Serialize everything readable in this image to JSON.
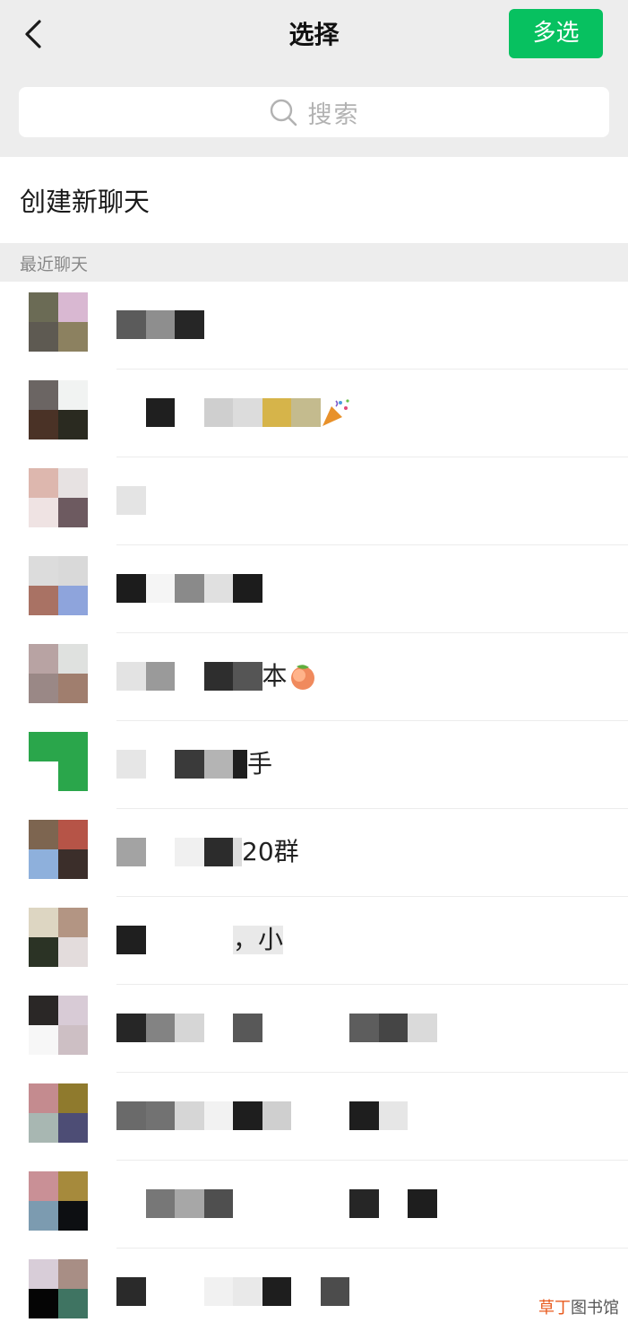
{
  "header": {
    "title": "选择",
    "multi_select_label": "多选"
  },
  "search": {
    "placeholder": "搜索"
  },
  "new_chat": {
    "label": "创建新聊天"
  },
  "recent": {
    "section_label": "最近聊天"
  },
  "chats": [
    {
      "visible_text": []
    },
    {
      "visible_text": []
    },
    {
      "visible_text": []
    },
    {
      "visible_text": []
    },
    {
      "visible_text": [
        "本"
      ]
    },
    {
      "visible_text": [
        "手"
      ]
    },
    {
      "visible_text": [
        "20群"
      ]
    },
    {
      "visible_text": [
        "，小"
      ]
    },
    {
      "visible_text": []
    },
    {
      "visible_text": []
    },
    {
      "visible_text": []
    },
    {
      "visible_text": []
    }
  ],
  "watermark": {
    "accent": "草丁",
    "rest": "图书馆"
  },
  "colors": {
    "accent_green": "#07c160",
    "topbar_bg": "#ededed",
    "divider": "#ececec"
  },
  "icons": {
    "back": "chevron-left-icon",
    "search": "search-icon"
  }
}
